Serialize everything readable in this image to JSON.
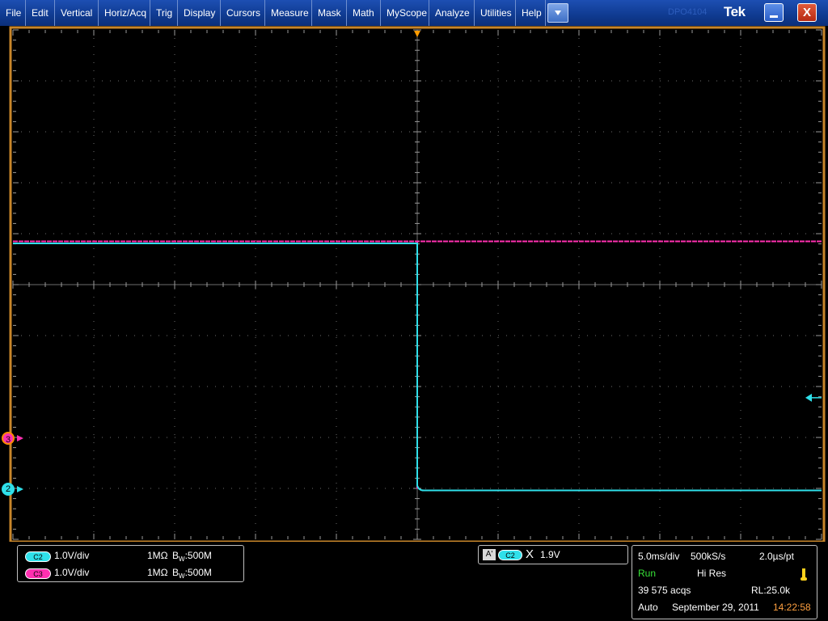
{
  "menu": {
    "items": [
      "File",
      "Edit",
      "Vertical",
      "Horiz/Acq",
      "Trig",
      "Display",
      "Cursors",
      "Measure",
      "Mask",
      "Math",
      "MyScope",
      "Analyze",
      "Utilities",
      "Help"
    ],
    "faint_label": "DPO4104",
    "brand": "Tek",
    "close_label": "X"
  },
  "channels": {
    "ch2": {
      "badge": "C2",
      "scale": "1.0V/div",
      "impedance": "1MΩ",
      "bw_prefix": "B",
      "bw_sub": "W",
      "bw_value": ":500M",
      "marker": "2",
      "color": "#2fe0ea"
    },
    "ch3": {
      "badge": "C3",
      "scale": "1.0V/div",
      "impedance": "1MΩ",
      "bw_prefix": "B",
      "bw_sub": "W",
      "bw_value": ":500M",
      "marker": "3",
      "color": "#ff2fb0"
    }
  },
  "trigger": {
    "mode_badge": "A'",
    "source_badge": "C2",
    "slope_symbol": "Χ",
    "level": "1.9V"
  },
  "acquisition": {
    "timebase": "5.0ms/div",
    "sample_rate": "500kS/s",
    "resolution": "2.0µs/pt",
    "state": "Run",
    "mode": "Hi Res",
    "acqs": "39 575 acqs",
    "record_length": "RL:25.0k",
    "trigger_mode": "Auto",
    "date": "September 29, 2011",
    "time": "14:22:58"
  },
  "colors": {
    "graticule_frame": "#c8862a",
    "grid": "#6e6e6e",
    "ch2": "#2fe0ea",
    "ch3": "#ff2fb0",
    "run_state": "#37e237",
    "time": "#ffa040",
    "trigger_pointer": "#ff9c00"
  },
  "waveforms": {
    "ch2_high_div": 4.85,
    "ch2_low_div": 0.0,
    "ch3_level_div": 5.85,
    "step_time_div": 5.0,
    "ch2_ground_div": 0,
    "ch3_ground_div": 1
  }
}
